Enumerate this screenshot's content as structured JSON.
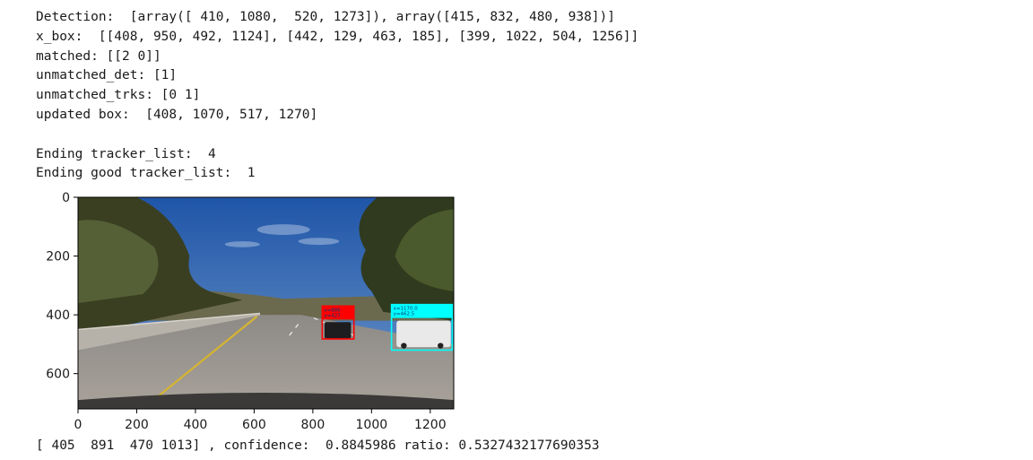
{
  "output": {
    "lines": [
      "Detection:  [array([ 410, 1080,  520, 1273]), array([415, 832, 480, 938])]",
      "x_box:  [[408, 950, 492, 1124], [442, 129, 463, 185], [399, 1022, 504, 1256]]",
      "matched: [[2 0]]",
      "unmatched_det: [1]",
      "unmatched_trks: [0 1]",
      "updated box:  [408, 1070, 517, 1270]",
      "",
      "Ending tracker_list:  4",
      "Ending good tracker_list:  1"
    ],
    "final_line": "[ 405  891  470 1013] , confidence:  0.8845986 ratio: 0.5327432177690353"
  },
  "figure": {
    "x_ticks": [
      "0",
      "200",
      "400",
      "600",
      "800",
      "1000",
      "1200"
    ],
    "y_ticks": [
      "0",
      "200",
      "400",
      "600"
    ],
    "x_range": [
      0,
      1280
    ],
    "y_range": [
      0,
      720
    ],
    "image_description_hidden": "road scene",
    "boxes": [
      {
        "name": "red-tracker-box",
        "color": "#ff0000",
        "x1": 832,
        "y1": 370,
        "x2": 940,
        "y2": 482,
        "labels": [
          "x=886",
          "y=427"
        ]
      },
      {
        "name": "cyan-tracker-box",
        "color": "#00ffff",
        "x1": 1068,
        "y1": 365,
        "x2": 1275,
        "y2": 520,
        "labels": [
          "x=1170.0",
          "y=462.5"
        ]
      }
    ]
  }
}
